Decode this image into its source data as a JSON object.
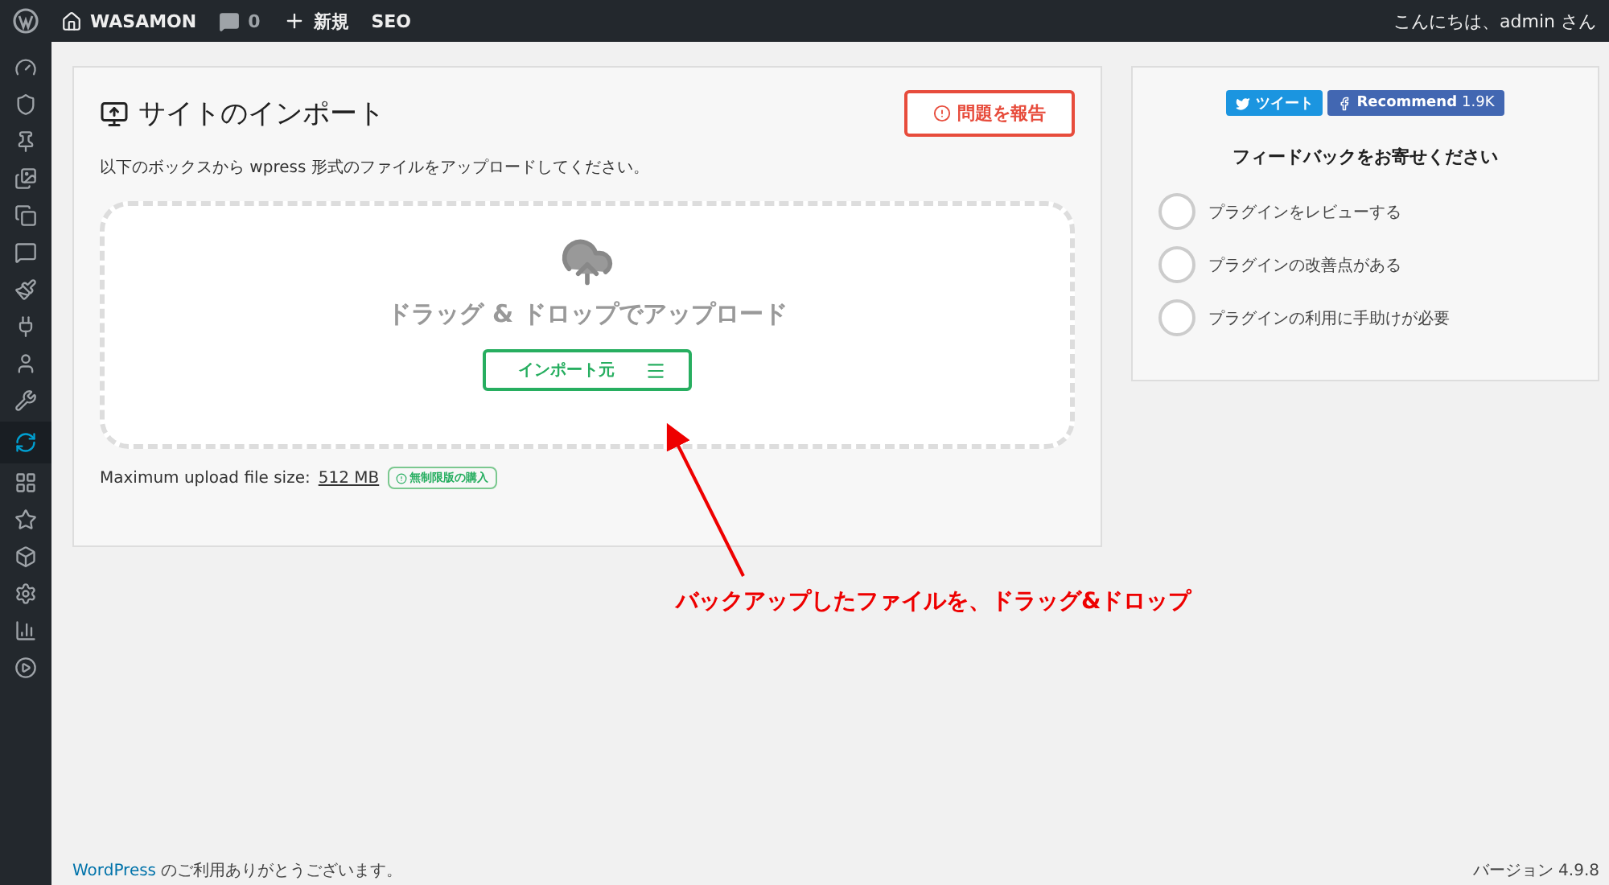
{
  "admin_bar": {
    "site_name": "WASAMON",
    "comments_count": "0",
    "new_label": "新規",
    "seo_label": "SEO",
    "greeting": "こんにちは、admin さん"
  },
  "sidebar": {
    "items": [
      {
        "selected": false
      },
      {
        "selected": false
      },
      {
        "selected": false
      },
      {
        "selected": false
      },
      {
        "selected": false
      },
      {
        "selected": false
      },
      {
        "selected": false
      },
      {
        "selected": false
      },
      {
        "selected": false
      },
      {
        "selected": false
      },
      {
        "selected": true
      },
      {
        "selected": false
      },
      {
        "selected": false
      },
      {
        "selected": false
      },
      {
        "selected": false
      },
      {
        "selected": false
      },
      {
        "selected": false
      }
    ]
  },
  "import_panel": {
    "title": "サイトのインポート",
    "report_button": "問題を報告",
    "instruction": "以下のボックスから wpress 形式のファイルをアップロードしてください。",
    "drop_text": "ドラッグ & ドロップでアップロード",
    "import_button": "インポート元",
    "max_size_label": "Maximum upload file size:",
    "max_size_value": "512 MB",
    "unlimited_badge": "無制限版の購入"
  },
  "feedback_panel": {
    "tweet_button": "ツイート",
    "recommend_button": "Recommend",
    "recommend_count": "1.9K",
    "title": "フィードバックをお寄せください",
    "options": [
      {
        "label": "プラグインをレビューする",
        "checked": false
      },
      {
        "label": "プラグインの改善点がある",
        "checked": false
      },
      {
        "label": "プラグインの利用に手助けが必要",
        "checked": false
      }
    ]
  },
  "annotation": {
    "text": "バックアップしたファイルを、ドラッグ&ドロップ"
  },
  "footer": {
    "link": "WordPress",
    "thanks": "のご利用ありがとうございます。",
    "version": "バージョン 4.9.8"
  }
}
